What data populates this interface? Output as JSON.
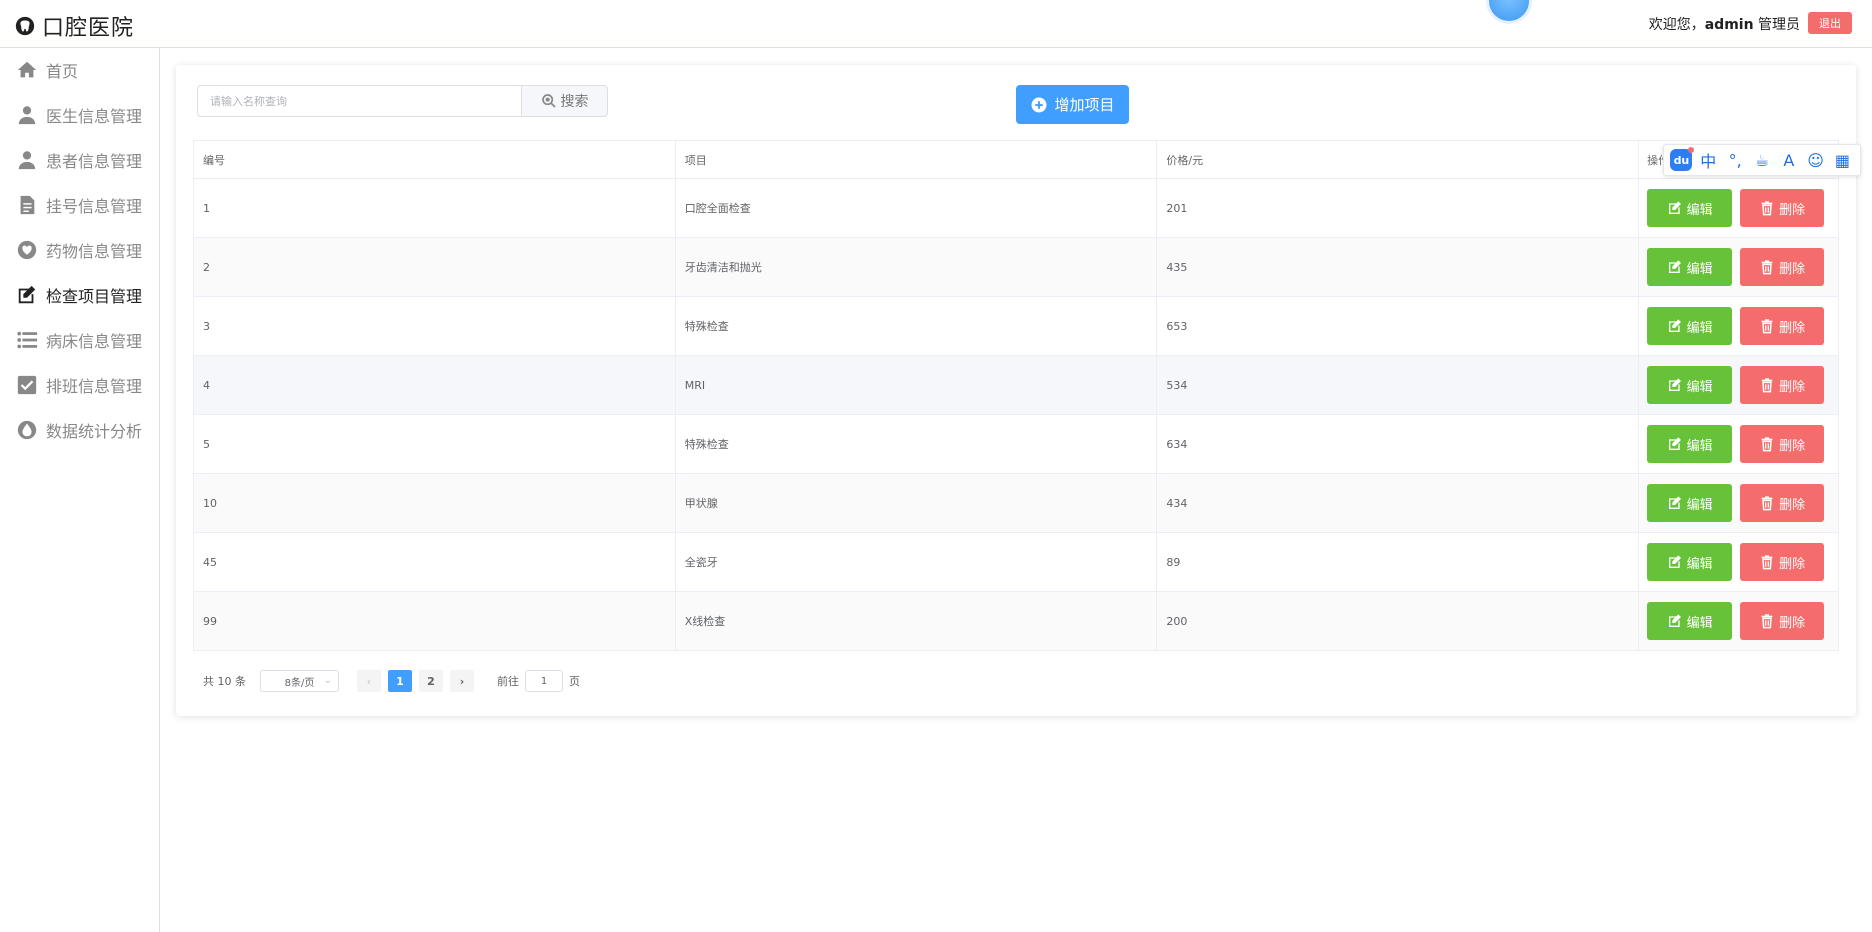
{
  "header": {
    "app_title": "口腔医院",
    "welcome_prefix": "欢迎您，",
    "username": "admin",
    "role": "管理员",
    "logout_label": "退出"
  },
  "sidebar": {
    "items": [
      {
        "label": "首页",
        "icon": "home-icon"
      },
      {
        "label": "医生信息管理",
        "icon": "user-icon"
      },
      {
        "label": "患者信息管理",
        "icon": "user-icon"
      },
      {
        "label": "挂号信息管理",
        "icon": "document-icon"
      },
      {
        "label": "药物信息管理",
        "icon": "heart-icon"
      },
      {
        "label": "检查项目管理",
        "icon": "edit-icon",
        "active": true
      },
      {
        "label": "病床信息管理",
        "icon": "list-icon"
      },
      {
        "label": "排班信息管理",
        "icon": "checkbox-icon"
      },
      {
        "label": "数据统计分析",
        "icon": "drop-icon"
      }
    ]
  },
  "toolbar": {
    "search_placeholder": "请输入名称查询",
    "search_label": "搜索",
    "add_label": "增加项目"
  },
  "table": {
    "headers": [
      "编号",
      "项目",
      "价格/元",
      "操作"
    ],
    "edit_label": "编辑",
    "delete_label": "删除",
    "rows": [
      {
        "id": "1",
        "name": "口腔全面检查",
        "price": "201"
      },
      {
        "id": "2",
        "name": "牙齿清洁和抛光",
        "price": "435"
      },
      {
        "id": "3",
        "name": "特殊检查",
        "price": "653"
      },
      {
        "id": "4",
        "name": "MRI",
        "price": "534"
      },
      {
        "id": "5",
        "name": "特殊检查",
        "price": "634"
      },
      {
        "id": "10",
        "name": "甲状腺",
        "price": "434"
      },
      {
        "id": "45",
        "name": "全瓷牙",
        "price": "89"
      },
      {
        "id": "99",
        "name": "X线检查",
        "price": "200"
      }
    ]
  },
  "pagination": {
    "total_text": "共 10 条",
    "page_size": "8条/页",
    "pages": [
      "1",
      "2"
    ],
    "current_page": "1",
    "goto_prefix": "前往",
    "goto_value": "1",
    "goto_suffix": "页"
  },
  "ime_toolbar": {
    "items": [
      "du",
      "中",
      "°,",
      "☕",
      "A",
      "☺",
      "▦"
    ]
  },
  "colors": {
    "primary": "#409eff",
    "success": "#67c23a",
    "danger": "#f56c6c"
  }
}
